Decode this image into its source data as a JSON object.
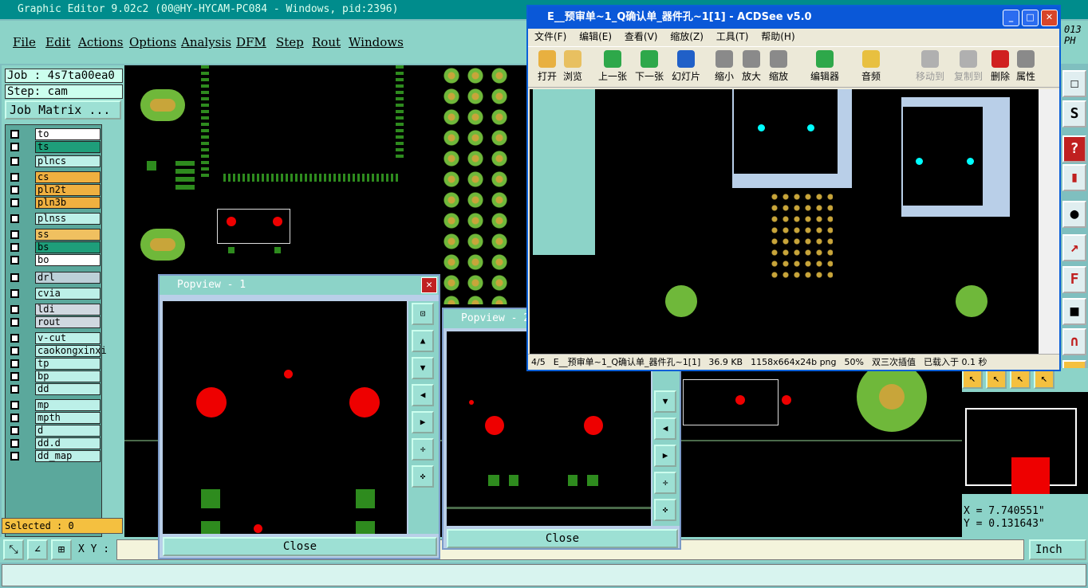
{
  "app": {
    "title": "Graphic Editor 9.02c2 (00@HY-HYCAM-PC084 - Windows, pid:2396)"
  },
  "menu": [
    "File",
    "Edit",
    "Actions",
    "Options",
    "Analysis",
    "DFM",
    "Step",
    "Rout",
    "Windows"
  ],
  "job": {
    "job_label": "Job : 4s7ta00ea0",
    "step_label": "Step: cam",
    "matrix_button": "Job Matrix ..."
  },
  "layers": [
    {
      "name": "to",
      "color": "#ffffff"
    },
    {
      "name": "ts",
      "color": "#1e9e7a"
    },
    {
      "name": "plncs",
      "color": "#bcf0e8"
    },
    {
      "name": "cs",
      "color": "#f0b040"
    },
    {
      "name": "pln2t",
      "color": "#f0b040"
    },
    {
      "name": "pln3b",
      "color": "#f0b040"
    },
    {
      "name": "plnss",
      "color": "#bcf0e8"
    },
    {
      "name": "ss",
      "color": "#f0c060"
    },
    {
      "name": "bs",
      "color": "#1e9e7a"
    },
    {
      "name": "bo",
      "color": "#ffffff"
    },
    {
      "name": "drl",
      "color": "#bcd0d8"
    },
    {
      "name": "cvia",
      "color": "#bcf0e8"
    },
    {
      "name": "ldi",
      "color": "#d0d8e0"
    },
    {
      "name": "rout",
      "color": "#d0d8e0"
    },
    {
      "name": "v-cut",
      "color": "#bcf0e8"
    },
    {
      "name": "caokongxinxi",
      "color": "#bcf0e8"
    },
    {
      "name": "tp",
      "color": "#bcf0e8"
    },
    {
      "name": "bp",
      "color": "#bcf0e8"
    },
    {
      "name": "dd",
      "color": "#bcf0e8"
    },
    {
      "name": "mp",
      "color": "#bcf0e8"
    },
    {
      "name": "mpth",
      "color": "#bcf0e8"
    },
    {
      "name": "d",
      "color": "#bcf0e8"
    },
    {
      "name": "dd.d",
      "color": "#bcf0e8"
    },
    {
      "name": "dd_map",
      "color": "#bcf0e8"
    }
  ],
  "status": {
    "selected": "Selected : 0"
  },
  "bottom": {
    "xy_label": "X Y :",
    "unit": "Inch"
  },
  "coords": {
    "x": "X =  7.740551\"",
    "y": "Y =  0.131643\""
  },
  "corner_text": {
    "year": "013",
    "ph": "PH"
  },
  "popups": {
    "p1_title": "Popview - 1",
    "p2_title": "Popview - 2",
    "close_label": "Close"
  },
  "acdsee": {
    "title": "E__预审单~1_Q确认单_器件孔~1[1] - ACDSee v5.0",
    "menu": [
      "文件(F)",
      "编辑(E)",
      "查看(V)",
      "缩放(Z)",
      "工具(T)",
      "帮助(H)"
    ],
    "toolbar": [
      "打开",
      "浏览",
      "上一张",
      "下一张",
      "幻灯片",
      "缩小",
      "放大",
      "缩放",
      "编辑器",
      "音频",
      "移动到",
      "复制到",
      "删除",
      "属性"
    ],
    "status": [
      "4/5",
      "E__预审单~1_Q确认单_器件孔~1[1]",
      "36.9 KB",
      "1158x664x24b png",
      "50%",
      "双三次插值",
      "已载入于 0.1 秒"
    ]
  },
  "colors": {
    "accent": "#8cd3c8",
    "board": "#000000",
    "pad": "#6fb83a",
    "drill": "#e00000"
  }
}
